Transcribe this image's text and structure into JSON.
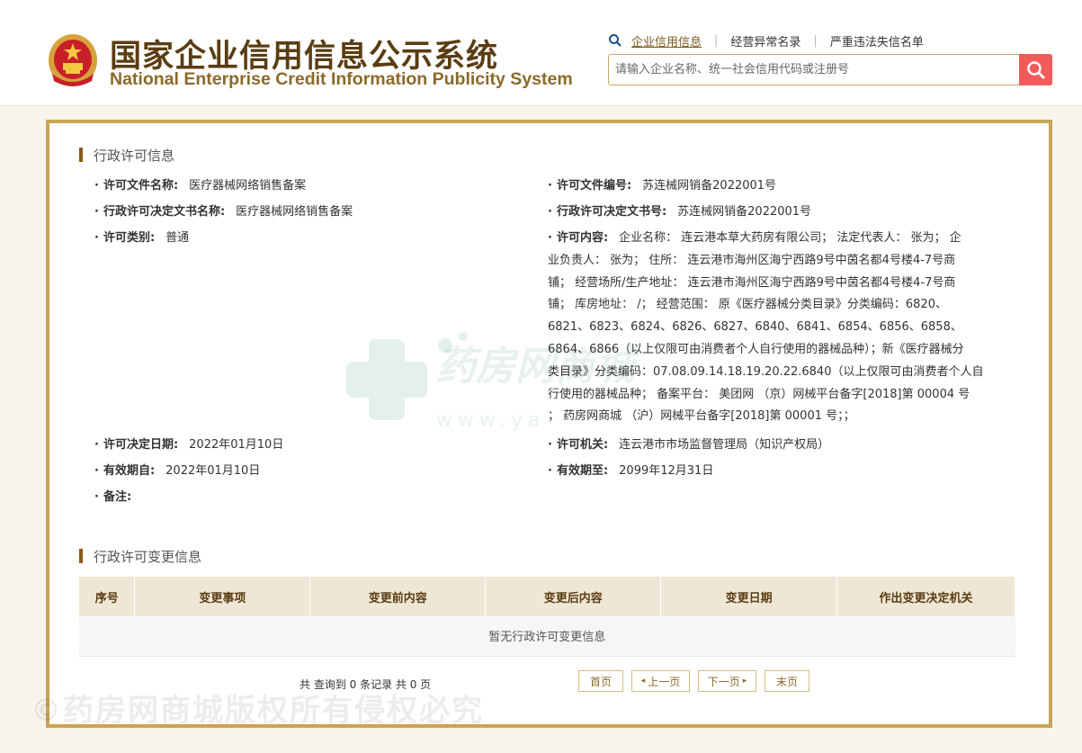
{
  "header": {
    "title_cn": "国家企业信用信息公示系统",
    "title_en": "National Enterprise Credit Information Publicity System"
  },
  "topnav": {
    "items": [
      {
        "label": "企业信用信息",
        "active": true
      },
      {
        "label": "经营异常名录",
        "active": false
      },
      {
        "label": "严重违法失信名单",
        "active": false
      }
    ],
    "separator": "|"
  },
  "search": {
    "placeholder": "请输入企业名称、统一社会信用代码或注册号"
  },
  "license_section": {
    "title": "行政许可信息",
    "fields": {
      "doc_name": {
        "label": "许可文件名称:",
        "value": "医疗器械网络销售备案"
      },
      "doc_no": {
        "label": "许可文件编号:",
        "value": "苏连械网销备2022001号"
      },
      "decision_name": {
        "label": "行政许可决定文书名称:",
        "value": "医疗器械网络销售备案"
      },
      "decision_no": {
        "label": "行政许可决定文书号:",
        "value": "苏连械网销备2022001号"
      },
      "category": {
        "label": "许可类别:",
        "value": "普通"
      },
      "content": {
        "label": "许可内容:",
        "lines": [
          "企业名称： 连云港本草大药房有限公司； 法定代表人： 张为； 企",
          "业负责人： 张为； 住所： 连云港市海州区海宁西路9号中茵名都4号楼4-7号商",
          "铺； 经营场所/生产地址： 连云港市海州区海宁西路9号中茵名都4号楼4-7号商",
          "铺； 库房地址： /； 经营范围： 原《医疗器械分类目录》分类编码：6820、",
          "6821、6823、6824、6826、6827、6840、6841、6854、6856、6858、",
          "6864、6866（以上仅限可由消费者个人自行使用的器械品种）；新《医疗器械分",
          "类目录》分类编码：07.08.09.14.18.19.20.22.6840（以上仅限可由消费者个人自",
          "行使用的器械品种； 备案平台： 美团网 （京）网械平台备字[2018]第 00004 号",
          "； 药房网商城 （沪）网械平台备字[2018]第 00001 号；；"
        ]
      },
      "decision_date": {
        "label": "许可决定日期:",
        "value": "2022年01月10日"
      },
      "authority": {
        "label": "许可机关:",
        "value": "连云港市市场监督管理局（知识产权局）"
      },
      "valid_from": {
        "label": "有效期自:",
        "value": "2022年01月10日"
      },
      "valid_to": {
        "label": "有效期至:",
        "value": "2099年12月31日"
      },
      "remark": {
        "label": "备注:",
        "value": ""
      }
    }
  },
  "change_section": {
    "title": "行政许可变更信息",
    "columns": [
      "序号",
      "变更事项",
      "变更前内容",
      "变更后内容",
      "变更日期",
      "作出变更决定机关"
    ],
    "empty_text": "暂无行政许可变更信息"
  },
  "pager": {
    "summary": "共 查询到 0 条记录 共 0 页",
    "first": "首页",
    "prev": "上一页",
    "next": "下一页",
    "last": "末页"
  },
  "watermark": {
    "brand_text": "药房网商城",
    "url_text": "www.ya",
    "copyright": "©药房网商城版权所有侵权必究"
  },
  "colors": {
    "brand_brown": "#5a3d12",
    "gold_border": "#c9a553",
    "search_button": "#f35b5b"
  }
}
